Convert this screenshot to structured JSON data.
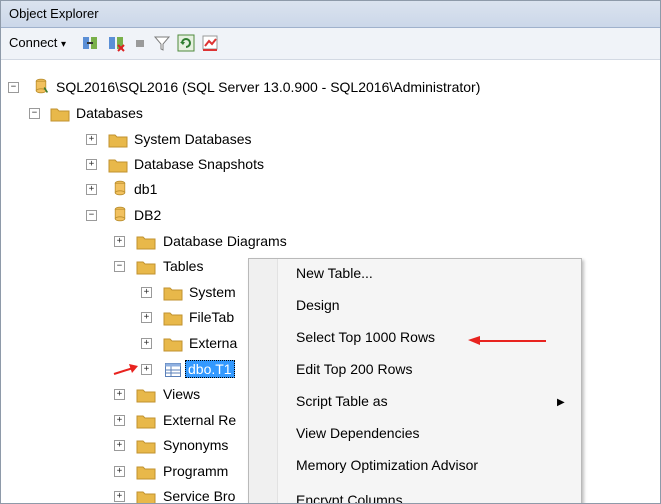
{
  "window": {
    "title": "Object Explorer"
  },
  "toolbar": {
    "connect_label": "Connect",
    "dropdown_glyph": "▾"
  },
  "tree": {
    "expand_glyph": "+",
    "collapse_glyph": "−",
    "server": "SQL2016\\SQL2016 (SQL Server 13.0.900 - SQL2016\\Administrator)",
    "databases": "Databases",
    "system_databases": "System Databases",
    "database_snapshots": "Database Snapshots",
    "db1": "db1",
    "db2": "DB2",
    "database_diagrams": "Database Diagrams",
    "tables": "Tables",
    "system_tables": "System",
    "filetables": "FileTab",
    "external_tables": "Externa",
    "dbo_t1": "dbo.T1",
    "views": "Views",
    "external_resources": "External Re",
    "synonyms": "Synonyms",
    "programmability": "Programm",
    "service_broker": "Service Bro"
  },
  "context_menu": {
    "items": [
      "New Table...",
      "Design",
      "Select Top 1000 Rows",
      "Edit Top 200 Rows",
      "Script Table as",
      "View Dependencies",
      "Memory Optimization Advisor",
      "Encrypt Columns..."
    ],
    "submenu_glyph": "▶"
  },
  "colors": {
    "arrow": "#e8231f",
    "selection": "#3399ff",
    "folder": "#e8b84a"
  }
}
